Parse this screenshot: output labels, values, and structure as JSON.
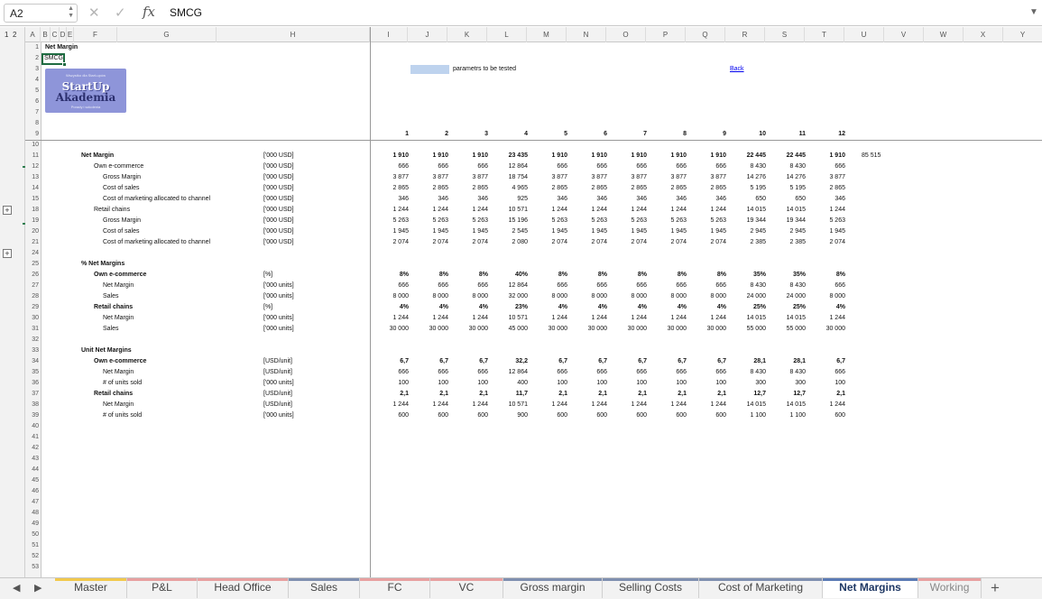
{
  "formula_bar": {
    "name_box": "A2",
    "formula": "SMCG",
    "fx": "fx",
    "cancel": "✕",
    "enter": "✓"
  },
  "outline": {
    "levels": [
      "1",
      "2"
    ],
    "plus": "+"
  },
  "columns": [
    "A",
    "B",
    "C",
    "D",
    "E",
    "F",
    "G",
    "H",
    "I",
    "J",
    "K",
    "L",
    "M",
    "N",
    "O",
    "P",
    "Q",
    "R",
    "S",
    "T",
    "U",
    "V",
    "W",
    "X",
    "Y"
  ],
  "rows": [
    "1",
    "2",
    "3",
    "4",
    "5",
    "6",
    "7",
    "8",
    "9",
    "10",
    "11",
    "12",
    "13",
    "14",
    "15",
    "18",
    "19",
    "20",
    "21",
    "24",
    "25",
    "26",
    "27",
    "28",
    "29",
    "30",
    "31",
    "32",
    "33",
    "34",
    "35",
    "36",
    "37",
    "38",
    "39",
    "40",
    "41",
    "42",
    "43",
    "44",
    "45",
    "46",
    "47",
    "48",
    "49",
    "50",
    "51",
    "52",
    "53"
  ],
  "sheet": {
    "title": "Net Margin",
    "selected_cell_text": "SMCG",
    "legend_label": "parametrs to be tested",
    "back_link": "Back",
    "logo": {
      "top": "Wszystko dla Start-upów",
      "line1": "StartUp",
      "line2": "Akademia",
      "bottom": "Porady i szkolenia"
    },
    "period_headers": [
      "1",
      "2",
      "3",
      "4",
      "5",
      "6",
      "7",
      "8",
      "9",
      "10",
      "11",
      "12"
    ],
    "extra_value": "85 515",
    "data_rows": [
      {
        "row": "11",
        "label": "Net Margin",
        "indent": 0,
        "bold": true,
        "unit": "['000 USD]",
        "values": [
          "1 910",
          "1 910",
          "1 910",
          "23 435",
          "1 910",
          "1 910",
          "1 910",
          "1 910",
          "1 910",
          "22 445",
          "22 445",
          "1 910"
        ]
      },
      {
        "row": "12",
        "label": "Own e-commerce",
        "indent": 1,
        "bold": false,
        "unit": "['000 USD]",
        "values": [
          "666",
          "666",
          "666",
          "12 864",
          "666",
          "666",
          "666",
          "666",
          "666",
          "8 430",
          "8 430",
          "666"
        ]
      },
      {
        "row": "13",
        "label": "Gross Margin",
        "indent": 2,
        "bold": false,
        "unit": "['000 USD]",
        "values": [
          "3 877",
          "3 877",
          "3 877",
          "18 754",
          "3 877",
          "3 877",
          "3 877",
          "3 877",
          "3 877",
          "14 276",
          "14 276",
          "3 877"
        ]
      },
      {
        "row": "14",
        "label": "Cost of sales",
        "indent": 2,
        "bold": false,
        "unit": "['000 USD]",
        "values": [
          "2 865",
          "2 865",
          "2 865",
          "4 965",
          "2 865",
          "2 865",
          "2 865",
          "2 865",
          "2 865",
          "5 195",
          "5 195",
          "2 865"
        ]
      },
      {
        "row": "15",
        "label": "Cost of marketing allocated to channel",
        "indent": 2,
        "bold": false,
        "unit": "['000 USD]",
        "values": [
          "346",
          "346",
          "346",
          "925",
          "346",
          "346",
          "346",
          "346",
          "346",
          "650",
          "650",
          "346"
        ]
      },
      {
        "row": "18",
        "label": "Retail chains",
        "indent": 1,
        "bold": false,
        "unit": "['000 USD]",
        "values": [
          "1 244",
          "1 244",
          "1 244",
          "10 571",
          "1 244",
          "1 244",
          "1 244",
          "1 244",
          "1 244",
          "14 015",
          "14 015",
          "1 244"
        ]
      },
      {
        "row": "19",
        "label": "Gross Margin",
        "indent": 2,
        "bold": false,
        "unit": "['000 USD]",
        "values": [
          "5 263",
          "5 263",
          "5 263",
          "15 196",
          "5 263",
          "5 263",
          "5 263",
          "5 263",
          "5 263",
          "19 344",
          "19 344",
          "5 263"
        ]
      },
      {
        "row": "20",
        "label": "Cost of sales",
        "indent": 2,
        "bold": false,
        "unit": "['000 USD]",
        "values": [
          "1 945",
          "1 945",
          "1 945",
          "2 545",
          "1 945",
          "1 945",
          "1 945",
          "1 945",
          "1 945",
          "2 945",
          "2 945",
          "1 945"
        ]
      },
      {
        "row": "21",
        "label": "Cost of marketing allocated to channel",
        "indent": 2,
        "bold": false,
        "unit": "['000 USD]",
        "values": [
          "2 074",
          "2 074",
          "2 074",
          "2 080",
          "2 074",
          "2 074",
          "2 074",
          "2 074",
          "2 074",
          "2 385",
          "2 385",
          "2 074"
        ]
      },
      {
        "row": "25",
        "label": "% Net Margins",
        "indent": 0,
        "bold": true,
        "unit": "",
        "values": []
      },
      {
        "row": "26",
        "label": "Own e-commerce",
        "indent": 1,
        "bold": true,
        "unit": "[%]",
        "values": [
          "8%",
          "8%",
          "8%",
          "40%",
          "8%",
          "8%",
          "8%",
          "8%",
          "8%",
          "35%",
          "35%",
          "8%"
        ]
      },
      {
        "row": "27",
        "label": "Net Margin",
        "indent": 2,
        "bold": false,
        "unit": "['000 units]",
        "values": [
          "666",
          "666",
          "666",
          "12 864",
          "666",
          "666",
          "666",
          "666",
          "666",
          "8 430",
          "8 430",
          "666"
        ]
      },
      {
        "row": "28",
        "label": "Sales",
        "indent": 2,
        "bold": false,
        "unit": "['000 units]",
        "values": [
          "8 000",
          "8 000",
          "8 000",
          "32 000",
          "8 000",
          "8 000",
          "8 000",
          "8 000",
          "8 000",
          "24 000",
          "24 000",
          "8 000"
        ]
      },
      {
        "row": "29",
        "label": "Retail chains",
        "indent": 1,
        "bold": true,
        "unit": "[%]",
        "values": [
          "4%",
          "4%",
          "4%",
          "23%",
          "4%",
          "4%",
          "4%",
          "4%",
          "4%",
          "25%",
          "25%",
          "4%"
        ]
      },
      {
        "row": "30",
        "label": "Net Margin",
        "indent": 2,
        "bold": false,
        "unit": "['000 units]",
        "values": [
          "1 244",
          "1 244",
          "1 244",
          "10 571",
          "1 244",
          "1 244",
          "1 244",
          "1 244",
          "1 244",
          "14 015",
          "14 015",
          "1 244"
        ]
      },
      {
        "row": "31",
        "label": "Sales",
        "indent": 2,
        "bold": false,
        "unit": "['000 units]",
        "values": [
          "30 000",
          "30 000",
          "30 000",
          "45 000",
          "30 000",
          "30 000",
          "30 000",
          "30 000",
          "30 000",
          "55 000",
          "55 000",
          "30 000"
        ]
      },
      {
        "row": "33",
        "label": "Unit Net Margins",
        "indent": 0,
        "bold": true,
        "unit": "",
        "values": []
      },
      {
        "row": "34",
        "label": "Own e-commerce",
        "indent": 1,
        "bold": true,
        "unit": "[USD/unit]",
        "values": [
          "6,7",
          "6,7",
          "6,7",
          "32,2",
          "6,7",
          "6,7",
          "6,7",
          "6,7",
          "6,7",
          "28,1",
          "28,1",
          "6,7"
        ]
      },
      {
        "row": "35",
        "label": "Net Margin",
        "indent": 2,
        "bold": false,
        "unit": "[USD/unit]",
        "values": [
          "666",
          "666",
          "666",
          "12 864",
          "666",
          "666",
          "666",
          "666",
          "666",
          "8 430",
          "8 430",
          "666"
        ]
      },
      {
        "row": "36",
        "label": "# of units sold",
        "indent": 2,
        "bold": false,
        "unit": "['000 units]",
        "values": [
          "100",
          "100",
          "100",
          "400",
          "100",
          "100",
          "100",
          "100",
          "100",
          "300",
          "300",
          "100"
        ]
      },
      {
        "row": "37",
        "label": "Retail chains",
        "indent": 1,
        "bold": true,
        "unit": "[USD/unit]",
        "values": [
          "2,1",
          "2,1",
          "2,1",
          "11,7",
          "2,1",
          "2,1",
          "2,1",
          "2,1",
          "2,1",
          "12,7",
          "12,7",
          "2,1"
        ]
      },
      {
        "row": "38",
        "label": "Net Margin",
        "indent": 2,
        "bold": false,
        "unit": "[USD/unit]",
        "values": [
          "1 244",
          "1 244",
          "1 244",
          "10 571",
          "1 244",
          "1 244",
          "1 244",
          "1 244",
          "1 244",
          "14 015",
          "14 015",
          "1 244"
        ]
      },
      {
        "row": "39",
        "label": "# of units sold",
        "indent": 2,
        "bold": false,
        "unit": "['000 units]",
        "values": [
          "600",
          "600",
          "600",
          "900",
          "600",
          "600",
          "600",
          "600",
          "600",
          "1 100",
          "1 100",
          "600"
        ]
      }
    ]
  },
  "tabs": [
    {
      "label": "Master",
      "color": "#f2c94c",
      "active": false
    },
    {
      "label": "P&L",
      "color": "#e8a0a0",
      "active": false
    },
    {
      "label": "Head Office",
      "color": "#e8a0a0",
      "active": false
    },
    {
      "label": "Sales",
      "color": "#7f8fb0",
      "active": false
    },
    {
      "label": "FC",
      "color": "#e8a0a0",
      "active": false
    },
    {
      "label": "VC",
      "color": "#e8a0a0",
      "active": false
    },
    {
      "label": "Gross margin",
      "color": "#7f8fb0",
      "active": false
    },
    {
      "label": "Selling Costs",
      "color": "#7f8fb0",
      "active": false
    },
    {
      "label": "Cost of Marketing",
      "color": "#7f8fb0",
      "active": false
    },
    {
      "label": "Net Margins",
      "color": "#5b7bb5",
      "active": true
    },
    {
      "label": "Working",
      "color": "#e8a0a0",
      "active": false
    }
  ],
  "tab_nav": {
    "prev": "◀",
    "next": "▶",
    "add": "+"
  }
}
